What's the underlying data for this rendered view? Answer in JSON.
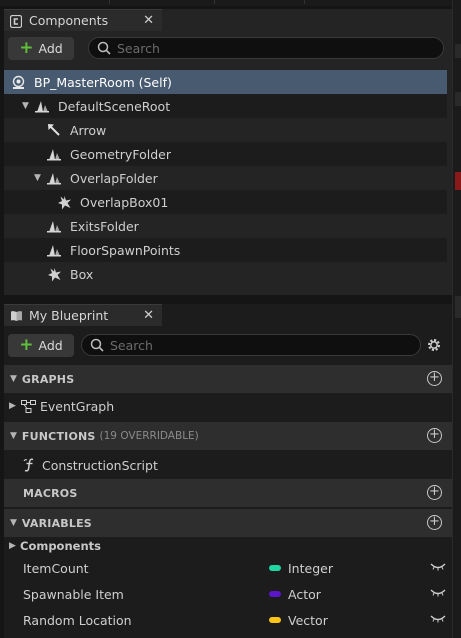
{
  "colors": {
    "panel_bg": "#242424",
    "selected_row": "#475a70",
    "add_plus": "#5fbf3a",
    "integer_pin": "#1fd6a3",
    "actor_pin": "#5b16c9",
    "vector_pin": "#f8c418"
  },
  "components_panel": {
    "tab_title": "Components",
    "close_glyph": "✕",
    "add_label": "Add",
    "search_placeholder": "Search",
    "tree": [
      {
        "label": "BP_MasterRoom (Self)",
        "icon": "self-icon",
        "level": 0,
        "selected": true
      },
      {
        "label": "DefaultSceneRoot",
        "icon": "scene-root-icon",
        "level": 1,
        "expanded": true
      },
      {
        "label": "Arrow",
        "icon": "arrow-component-icon",
        "level": 2
      },
      {
        "label": "GeometryFolder",
        "icon": "scene-component-icon",
        "level": 2
      },
      {
        "label": "OverlapFolder",
        "icon": "scene-component-icon",
        "level": 2,
        "expanded": true
      },
      {
        "label": "OverlapBox01",
        "icon": "box-collision-icon",
        "level": 3
      },
      {
        "label": "ExitsFolder",
        "icon": "scene-component-icon",
        "level": 2
      },
      {
        "label": "FloorSpawnPoints",
        "icon": "scene-component-icon",
        "level": 2
      },
      {
        "label": "Box",
        "icon": "box-collision-icon",
        "level": 2
      }
    ]
  },
  "blueprint_panel": {
    "tab_title": "My Blueprint",
    "close_glyph": "✕",
    "add_label": "Add",
    "search_placeholder": "Search",
    "sections": {
      "graphs": {
        "title": "GRAPHS",
        "items": [
          "EventGraph"
        ]
      },
      "functions": {
        "title": "FUNCTIONS",
        "subtitle": "(19 OVERRIDABLE)",
        "items": [
          "ConstructionScript"
        ]
      },
      "macros": {
        "title": "MACROS"
      },
      "variables": {
        "title": "VARIABLES",
        "category": "Components",
        "items": [
          {
            "name": "ItemCount",
            "type": "Integer",
            "color": "#1fd6a3"
          },
          {
            "name": "Spawnable Item",
            "type": "Actor",
            "color": "#5b16c9"
          },
          {
            "name": "Random Location",
            "type": "Vector",
            "color": "#f8c418"
          }
        ]
      }
    }
  }
}
